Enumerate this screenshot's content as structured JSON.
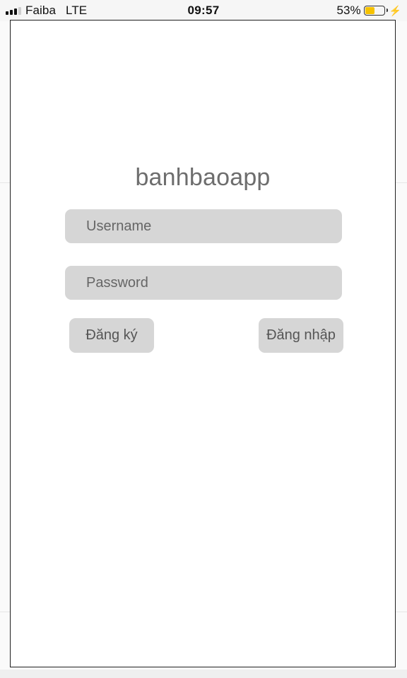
{
  "status_bar": {
    "carrier": "Faiba",
    "network": "LTE",
    "time": "09:57",
    "battery_percent": "53%",
    "battery_level": 0.53,
    "battery_color": "#f6c200",
    "charging_icon": "bolt-icon",
    "signal_icon": "cellular-signal-icon"
  },
  "app": {
    "title": "banhbaoapp",
    "username": {
      "placeholder": "Username",
      "value": ""
    },
    "password": {
      "placeholder": "Password",
      "value": ""
    },
    "register_label": "Đăng ký",
    "login_label": "Đăng nhập"
  },
  "colors": {
    "field_background": "#d6d6d6",
    "title_color": "#6d6d6d",
    "frame_border": "#1f1f1f"
  }
}
